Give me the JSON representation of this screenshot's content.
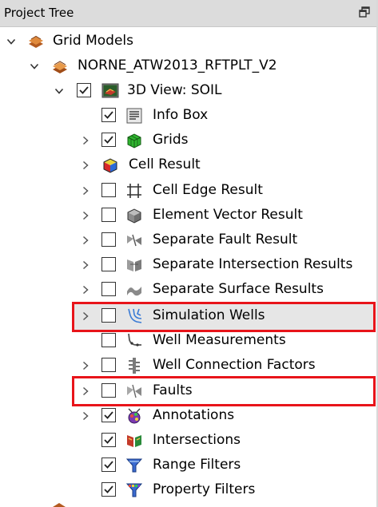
{
  "panel": {
    "title": "Project Tree"
  },
  "tree": {
    "grid_models": "Grid Models",
    "case": "NORNE_ATW2013_RFTPLT_V2",
    "view": "3D View: SOIL",
    "items": [
      {
        "label": "Info Box",
        "checked": true
      },
      {
        "label": "Grids",
        "checked": true
      },
      {
        "label": "Cell Result",
        "checked": null
      },
      {
        "label": "Cell Edge Result",
        "checked": false
      },
      {
        "label": "Element Vector Result",
        "checked": false
      },
      {
        "label": "Separate Fault Result",
        "checked": false
      },
      {
        "label": "Separate Intersection Results",
        "checked": false
      },
      {
        "label": "Separate Surface Results",
        "checked": false
      },
      {
        "label": "Simulation Wells",
        "checked": false
      },
      {
        "label": "Well Measurements",
        "checked": false
      },
      {
        "label": "Well Connection Factors",
        "checked": false
      },
      {
        "label": "Faults",
        "checked": false
      },
      {
        "label": "Annotations",
        "checked": true
      },
      {
        "label": "Intersections",
        "checked": true
      },
      {
        "label": "Range Filters",
        "checked": true
      },
      {
        "label": "Property Filters",
        "checked": true
      }
    ]
  },
  "colors": {
    "highlight": "#e8141a",
    "title_bg": "#dcdcdc",
    "selected_row_bg": "#e6e6e6"
  }
}
